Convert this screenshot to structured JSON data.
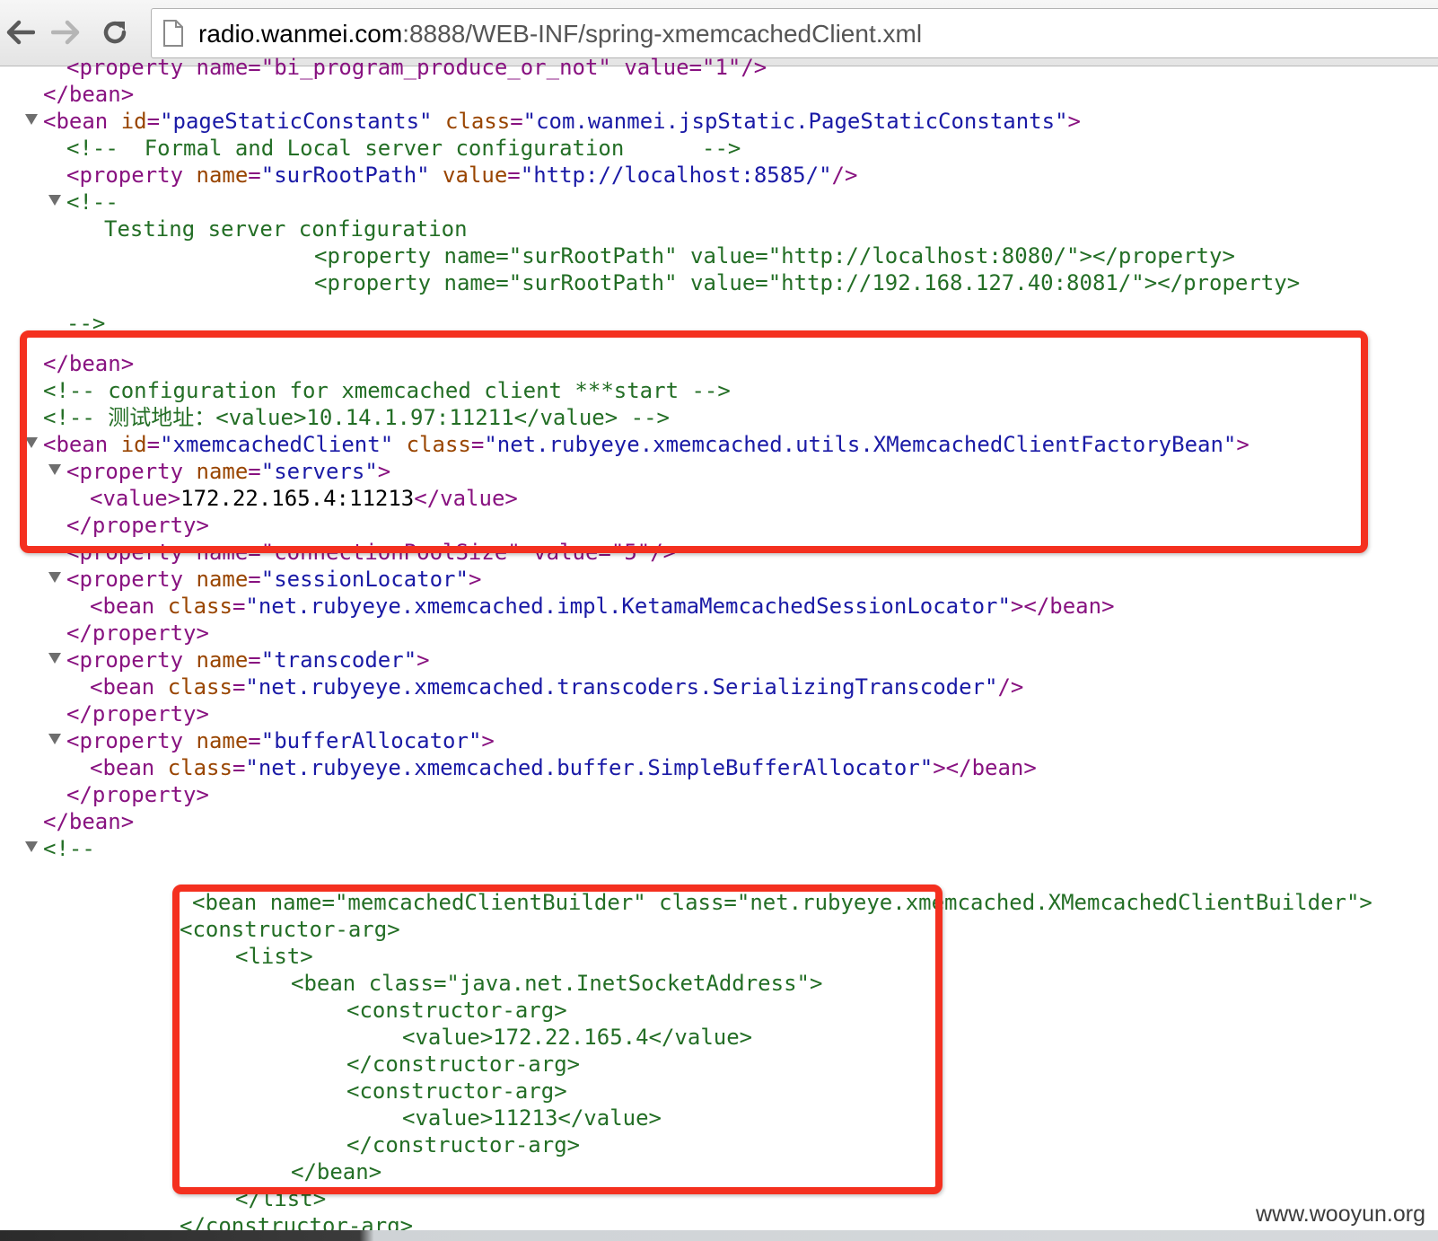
{
  "browser": {
    "url_host": "radio.wanmei.com",
    "url_rest": ":8888/WEB-INF/spring-xmemcachedClient.xml"
  },
  "watermark": "www.wooyun.org",
  "colors": {
    "tag": "#881280",
    "attribute": "#994500",
    "value": "#1a1aa6",
    "comment": "#236e25",
    "highlight": "#f4301f"
  },
  "xml": {
    "l0": "<property name=\"bi_program_produce_or_not\" value=\"1\"/>",
    "l1": "</bean>",
    "l2": {
      "open": "<bean",
      "attr1": "id",
      "val1": "\"pageStaticConstants\"",
      "attr2": "class",
      "val2": "\"com.wanmei.jspStatic.PageStaticConstants\"",
      "close": ">"
    },
    "l3": "<!--  Formal and Local server configuration      -->",
    "l4": {
      "open": "<property",
      "attr1": "name",
      "val1": "\"surRootPath\"",
      "attr2": "value",
      "val2": "\"http://localhost:8585/\"",
      "close": "/>"
    },
    "l5": "<!--",
    "l6": "Testing server configuration",
    "l7": "<property name=\"surRootPath\" value=\"http://localhost:8080/\"></property>",
    "l8": "<property name=\"surRootPath\" value=\"http://192.168.127.40:8081/\"></property>",
    "l9": "-->",
    "l10": "</bean>",
    "l11": "<!-- configuration for xmemcached client ***start -->",
    "l12": "<!-- 测试地址：<value>10.14.1.97:11211</value> -->",
    "l13": {
      "open": "<bean",
      "attr1": "id",
      "val1": "\"xmemcachedClient\"",
      "attr2": "class",
      "val2": "\"net.rubyeye.xmemcached.utils.XMemcachedClientFactoryBean\"",
      "close": ">"
    },
    "l14": {
      "open": "<property",
      "attr1": "name",
      "val1": "\"servers\"",
      "close": ">"
    },
    "l15": {
      "open": "<value>",
      "text": "172.22.165.4:11213",
      "close": "</value>"
    },
    "l16": "</property>",
    "l17": "<property name=\"connectionPoolSize\" value=\"5\"/>",
    "l18": {
      "open": "<property",
      "attr1": "name",
      "val1": "\"sessionLocator\"",
      "close": ">"
    },
    "l19": {
      "open": "<bean",
      "attr1": "class",
      "val1": "\"net.rubyeye.xmemcached.impl.KetamaMemcachedSessionLocator\"",
      "close": "></bean>"
    },
    "l20": "</property>",
    "l21": {
      "open": "<property",
      "attr1": "name",
      "val1": "\"transcoder\"",
      "close": ">"
    },
    "l22": {
      "open": "<bean",
      "attr1": "class",
      "val1": "\"net.rubyeye.xmemcached.transcoders.SerializingTranscoder\"",
      "close": "/>"
    },
    "l23": "</property>",
    "l24": {
      "open": "<property",
      "attr1": "name",
      "val1": "\"bufferAllocator\"",
      "close": ">"
    },
    "l25": {
      "open": "<bean",
      "attr1": "class",
      "val1": "\"net.rubyeye.xmemcached.buffer.SimpleBufferAllocator\"",
      "close": "></bean>"
    },
    "l26": "</property>",
    "l27": "</bean>",
    "l28": "<!--",
    "l29": "<bean name=\"memcachedClientBuilder\" class=\"net.rubyeye.xmemcached.XMemcachedClientBuilder\">",
    "l30": "<constructor-arg>",
    "l31": "<list>",
    "l32": "<bean class=\"java.net.InetSocketAddress\">",
    "l33": "<constructor-arg>",
    "l34": "<value>172.22.165.4</value>",
    "l35": "</constructor-arg>",
    "l36": "<constructor-arg>",
    "l37": "<value>11213</value>",
    "l38": "</constructor-arg>",
    "l39": "</bean>",
    "l40": "</list>",
    "l41": "</constructor-arg>"
  }
}
